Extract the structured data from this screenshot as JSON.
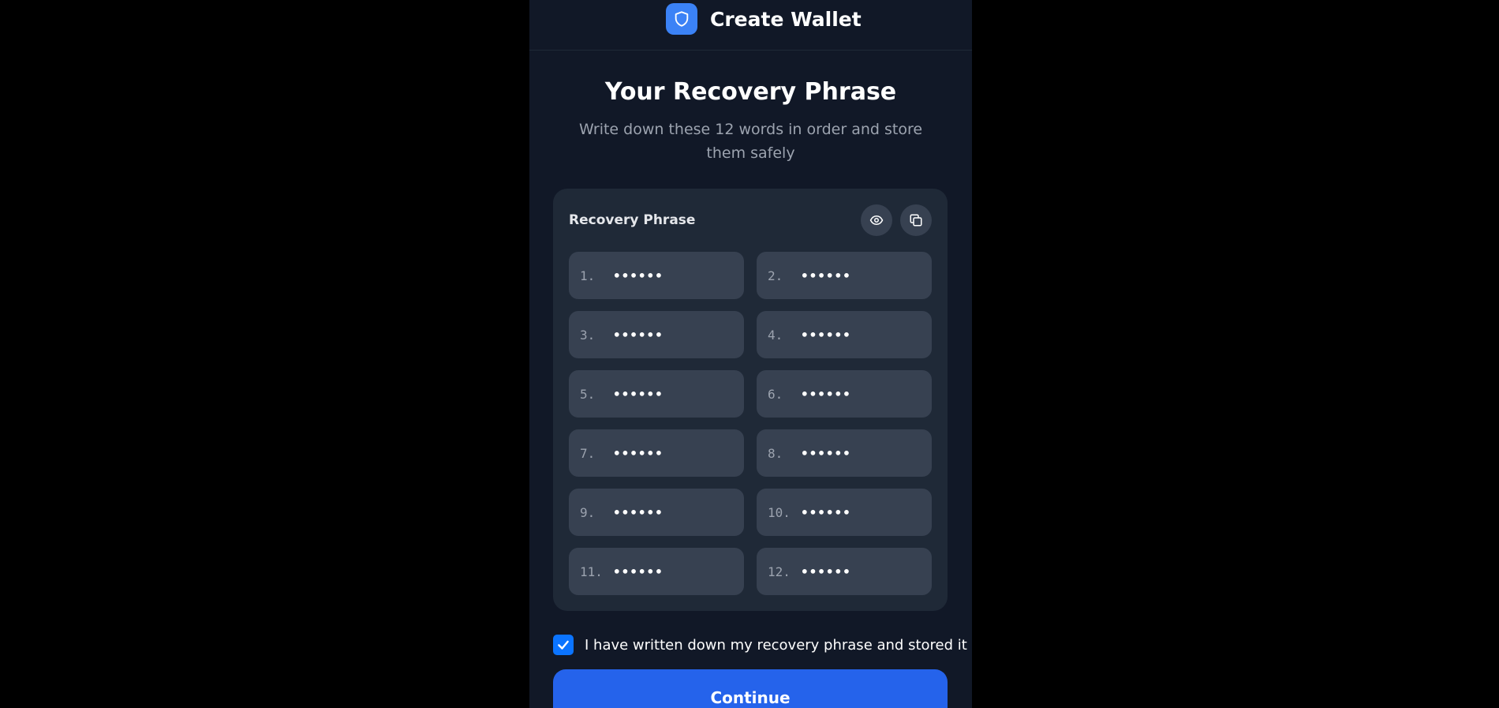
{
  "header": {
    "title": "Create Wallet",
    "logo_icon": "shield-icon",
    "accent": "#3b82f6"
  },
  "main": {
    "title": "Your Recovery Phrase",
    "subtitle": "Write down these 12 words in order and store them safely"
  },
  "phrase_card": {
    "label": "Recovery Phrase",
    "actions": [
      {
        "name": "toggle-visibility",
        "icon": "eye-icon"
      },
      {
        "name": "copy",
        "icon": "copy-icon"
      }
    ],
    "words": [
      {
        "num": "1.",
        "value": "••••••"
      },
      {
        "num": "2.",
        "value": "••••••"
      },
      {
        "num": "3.",
        "value": "••••••"
      },
      {
        "num": "4.",
        "value": "••••••"
      },
      {
        "num": "5.",
        "value": "••••••"
      },
      {
        "num": "6.",
        "value": "••••••"
      },
      {
        "num": "7.",
        "value": "••••••"
      },
      {
        "num": "8.",
        "value": "••••••"
      },
      {
        "num": "9.",
        "value": "••••••"
      },
      {
        "num": "10.",
        "value": "••••••"
      },
      {
        "num": "11.",
        "value": "••••••"
      },
      {
        "num": "12.",
        "value": "••••••"
      }
    ]
  },
  "confirm": {
    "checked": true,
    "label": "I have written down my recovery phrase and stored it safely"
  },
  "continue_button": {
    "label": "Continue",
    "color": "#2563eb"
  }
}
